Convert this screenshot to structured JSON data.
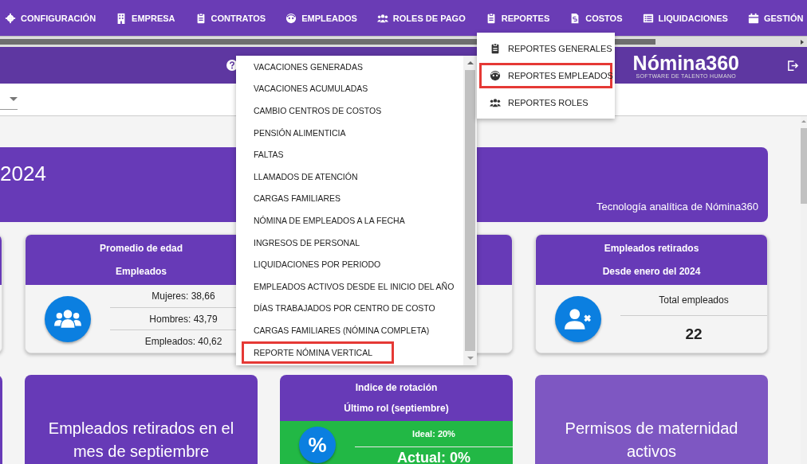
{
  "nav": {
    "items": [
      {
        "label": "CONFIGURACIÓN"
      },
      {
        "label": "EMPRESA"
      },
      {
        "label": "CONTRATOS"
      },
      {
        "label": "EMPLEADOS"
      },
      {
        "label": "ROLES DE PAGO"
      },
      {
        "label": "REPORTES"
      },
      {
        "label": "COSTOS"
      },
      {
        "label": "LIQUIDACIONES"
      },
      {
        "label": "GESTIÓN"
      }
    ]
  },
  "header": {
    "logo": "Nómina360",
    "tagline": "SOFTWARE DE TALENTO HUMANO"
  },
  "banner": {
    "title": "2024",
    "subtitle": "Tecnología analítica de Nómina360"
  },
  "cards_row_1": [
    {
      "kind": "blank"
    },
    {
      "kind": "stats",
      "title": "Promedio de edad",
      "subtitle": "Empleados",
      "lines": [
        "Mujeres: 38,66",
        "Hombres: 43,79",
        "Empleados: 40,62"
      ]
    },
    {
      "kind": "covered"
    },
    {
      "kind": "total",
      "title": "Empleados retirados",
      "subtitle": "Desde enero del 2024",
      "label": "Total empleados",
      "value": "22"
    }
  ],
  "cards_row_2": [
    {
      "kind": "blank"
    },
    {
      "kind": "text",
      "color": "#673ab7",
      "text": "Empleados retirados en el mes de septiembre"
    },
    {
      "kind": "rotation",
      "title": "Indice de rotación",
      "subtitle": "Último rol (septiembre)",
      "symbol": "%",
      "ideal": "Ideal: 20%",
      "actual": "Actual: 0%"
    },
    {
      "kind": "text",
      "color": "#7e57c2",
      "text": "Permisos de maternidad activos"
    }
  ],
  "report_list": {
    "items": [
      {
        "label": "VACACIONES GENERADAS",
        "selected": false
      },
      {
        "label": "VACACIONES ACUMULADAS",
        "selected": false
      },
      {
        "label": "CAMBIO CENTROS DE COSTOS",
        "selected": false
      },
      {
        "label": "PENSIÓN ALIMENTICIA",
        "selected": false
      },
      {
        "label": "FALTAS",
        "selected": false
      },
      {
        "label": "LLAMADOS DE ATENCIÓN",
        "selected": false
      },
      {
        "label": "CARGAS FAMILIARES",
        "selected": false
      },
      {
        "label": "NÓMINA DE EMPLEADOS A LA FECHA",
        "selected": false
      },
      {
        "label": "INGRESOS DE PERSONAL",
        "selected": false
      },
      {
        "label": "LIQUIDACIONES POR PERIODO",
        "selected": false
      },
      {
        "label": "EMPLEADOS ACTIVOS DESDE EL INICIO DEL AÑO",
        "selected": false
      },
      {
        "label": "DÍAS TRABAJADOS POR CENTRO DE COSTO",
        "selected": false
      },
      {
        "label": "CARGAS FAMILIARES (NÓMINA COMPLETA)",
        "selected": false
      },
      {
        "label": "REPORTE NÓMINA VERTICAL",
        "selected": true
      }
    ]
  },
  "reports_menu": {
    "items": [
      {
        "label": "REPORTES GENERALES",
        "selected": false
      },
      {
        "label": "REPORTES EMPLEADOS",
        "selected": true
      },
      {
        "label": "REPORTES ROLES",
        "selected": false
      }
    ]
  }
}
